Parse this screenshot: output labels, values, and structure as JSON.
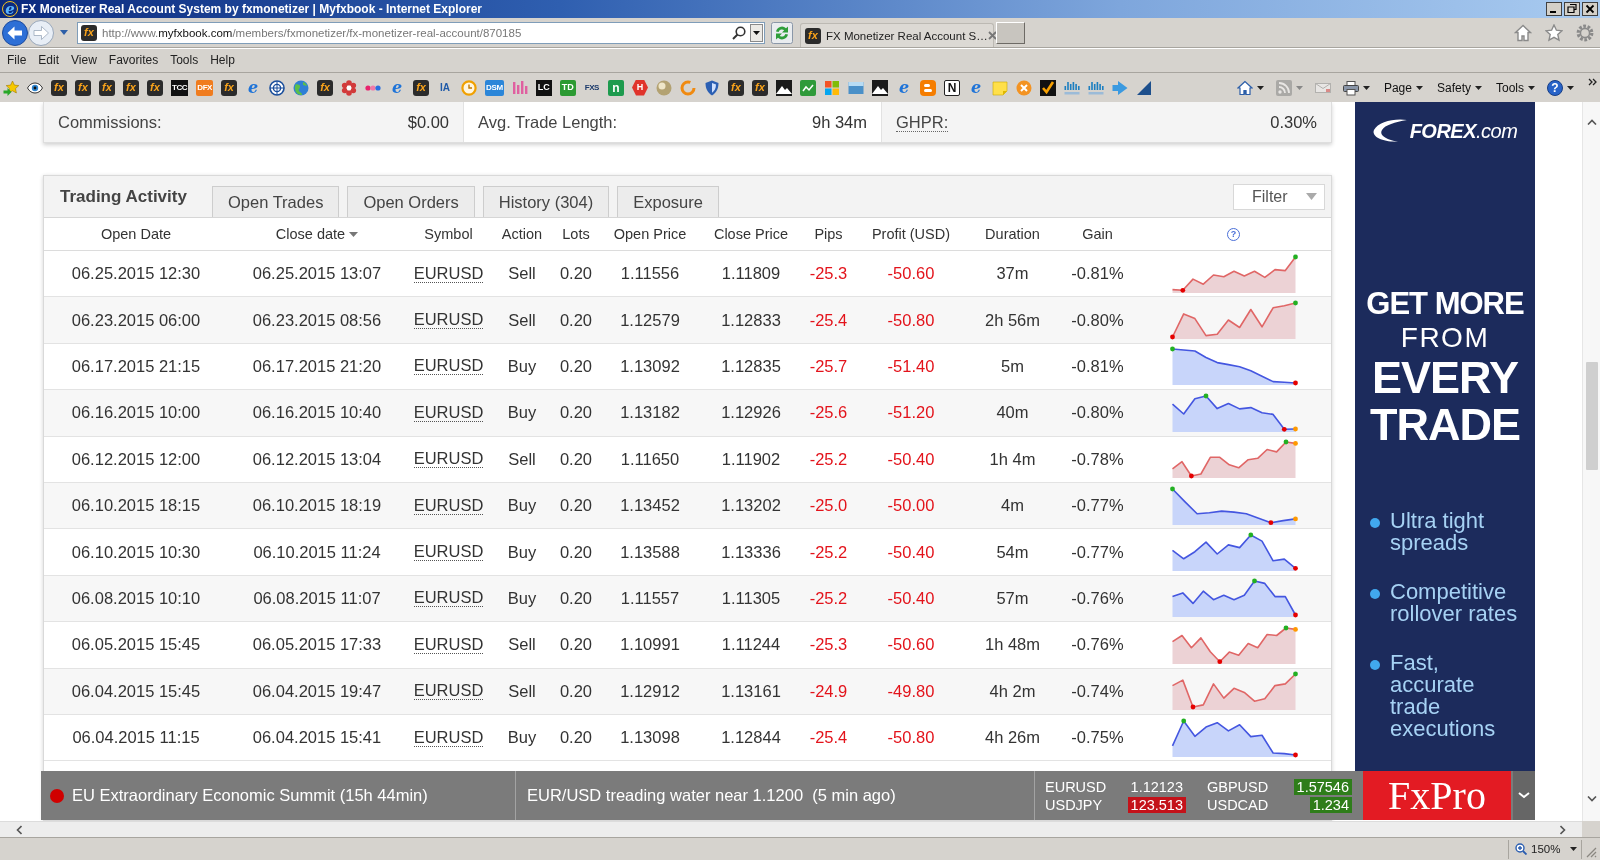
{
  "window": {
    "icon_text": "e",
    "title": "FX Monetizer Real Account System by fxmonetizer | Myfxbook - Internet Explorer"
  },
  "address": {
    "favicon_text": "fx",
    "url_start": "http://www.",
    "url_host": "myfxbook.com",
    "url_path": "/members/fxmonetizer/fx-monetizer-real-account/870185"
  },
  "tab": {
    "favicon_text": "fx",
    "title": "FX Monetizer Real Account S…"
  },
  "menu": [
    "File",
    "Edit",
    "View",
    "Favorites",
    "Tools",
    "Help"
  ],
  "favorites": [
    {
      "kind": "add"
    },
    {
      "kind": "eye"
    },
    {
      "kind": "fx",
      "text": "fx"
    },
    {
      "kind": "fx",
      "text": "fx"
    },
    {
      "kind": "fx",
      "text": "fx"
    },
    {
      "kind": "fx",
      "text": "fx"
    },
    {
      "kind": "fx",
      "text": "fx"
    },
    {
      "kind": "dark",
      "text": "TCC"
    },
    {
      "kind": "solid",
      "text": "DFX",
      "color": "#f07c1e"
    },
    {
      "kind": "fx",
      "text": "fx"
    },
    {
      "kind": "ie",
      "text": "e"
    },
    {
      "kind": "target"
    },
    {
      "kind": "globe"
    },
    {
      "kind": "fx",
      "text": "fx"
    },
    {
      "kind": "flower"
    },
    {
      "kind": "dots"
    },
    {
      "kind": "ie",
      "text": "e"
    },
    {
      "kind": "fx",
      "text": "fx"
    },
    {
      "kind": "plain",
      "text": "IA",
      "color": "#1f5aa8"
    },
    {
      "kind": "clock"
    },
    {
      "kind": "solid",
      "text": "DSM",
      "color": "#2b86d9"
    },
    {
      "kind": "bars"
    },
    {
      "kind": "dark",
      "text": "LC"
    },
    {
      "kind": "solid",
      "text": "TD",
      "color": "#2c9a32"
    },
    {
      "kind": "plain",
      "text": "FXS",
      "color": "#1b3a6b"
    },
    {
      "kind": "solid",
      "text": "n",
      "color": "#1e9b4e"
    },
    {
      "kind": "hex",
      "text": "H",
      "color": "#e0342c"
    },
    {
      "kind": "ball"
    },
    {
      "kind": "ring"
    },
    {
      "kind": "shield"
    },
    {
      "kind": "fx",
      "text": "fx"
    },
    {
      "kind": "fx",
      "text": "fx"
    },
    {
      "kind": "mountain"
    },
    {
      "kind": "chart"
    },
    {
      "kind": "windows"
    },
    {
      "kind": "window"
    },
    {
      "kind": "mountain"
    },
    {
      "kind": "ie",
      "text": "e"
    },
    {
      "kind": "blog"
    },
    {
      "kind": "outline",
      "text": "N"
    },
    {
      "kind": "ie",
      "text": "e"
    },
    {
      "kind": "note"
    },
    {
      "kind": "xcircle"
    },
    {
      "kind": "check"
    },
    {
      "kind": "cisco"
    },
    {
      "kind": "cisco"
    },
    {
      "kind": "plane"
    },
    {
      "kind": "slope"
    }
  ],
  "command_bar": [
    {
      "kind": "home",
      "disabled": false
    },
    {
      "kind": "feeds",
      "disabled": true
    },
    {
      "kind": "mail",
      "disabled": true
    },
    {
      "kind": "print",
      "disabled": false
    },
    {
      "kind": "menu",
      "label": "Page",
      "disabled": false
    },
    {
      "kind": "menu",
      "label": "Safety",
      "disabled": false
    },
    {
      "kind": "menu",
      "label": "Tools",
      "disabled": false
    },
    {
      "kind": "help",
      "label": "?",
      "disabled": false
    }
  ],
  "stats": [
    {
      "kind": "plain",
      "label": "Commissions:",
      "value": "$0.00"
    },
    {
      "kind": "plain",
      "label": "Avg. Trade Length:",
      "value": "9h 34m"
    },
    {
      "kind": "term",
      "label": "GHPR:",
      "value": "0.30%"
    }
  ],
  "activity": {
    "title": "Trading Activity",
    "tabs": [
      {
        "label": "Open Trades",
        "selected": false
      },
      {
        "label": "Open Orders",
        "selected": false
      },
      {
        "label": "History (304)",
        "selected": false
      },
      {
        "label": "Exposure",
        "selected": false
      }
    ],
    "filter": "Filter",
    "columns": [
      {
        "kind": "text",
        "label": "Open Date",
        "sorted": false
      },
      {
        "kind": "text",
        "label": "Close date",
        "sorted": true
      },
      {
        "kind": "text",
        "label": "Symbol",
        "sorted": false
      },
      {
        "kind": "text",
        "label": "Action",
        "sorted": false
      },
      {
        "kind": "text",
        "label": "Lots",
        "sorted": false
      },
      {
        "kind": "text",
        "label": "Open Price",
        "sorted": false
      },
      {
        "kind": "text",
        "label": "Close Price",
        "sorted": false
      },
      {
        "kind": "text",
        "label": "Pips",
        "sorted": false
      },
      {
        "kind": "text",
        "label": "Profit (USD)",
        "sorted": false
      },
      {
        "kind": "text",
        "label": "Duration",
        "sorted": false
      },
      {
        "kind": "text",
        "label": "Gain",
        "sorted": false
      },
      {
        "kind": "help",
        "label": "?",
        "sorted": false
      }
    ],
    "rows": [
      {
        "kind": "sell",
        "open_date": "06.25.2015 12:30",
        "close_date": "06.25.2015 13:07",
        "symbol": "EURUSD",
        "action": "Sell",
        "lots": "0.20",
        "open_price": "1.11556",
        "close_price": "1.11809",
        "pips": "-25.3",
        "profit": "-50.60",
        "duration": "37m",
        "gain": "-0.81%"
      },
      {
        "kind": "sell",
        "open_date": "06.23.2015 06:00",
        "close_date": "06.23.2015 08:56",
        "symbol": "EURUSD",
        "action": "Sell",
        "lots": "0.20",
        "open_price": "1.12579",
        "close_price": "1.12833",
        "pips": "-25.4",
        "profit": "-50.80",
        "duration": "2h 56m",
        "gain": "-0.80%"
      },
      {
        "kind": "buy",
        "open_date": "06.17.2015 21:15",
        "close_date": "06.17.2015 21:20",
        "symbol": "EURUSD",
        "action": "Buy",
        "lots": "0.20",
        "open_price": "1.13092",
        "close_price": "1.12835",
        "pips": "-25.7",
        "profit": "-51.40",
        "duration": "5m",
        "gain": "-0.81%"
      },
      {
        "kind": "buy",
        "open_date": "06.16.2015 10:00",
        "close_date": "06.16.2015 10:40",
        "symbol": "EURUSD",
        "action": "Buy",
        "lots": "0.20",
        "open_price": "1.13182",
        "close_price": "1.12926",
        "pips": "-25.6",
        "profit": "-51.20",
        "duration": "40m",
        "gain": "-0.80%"
      },
      {
        "kind": "sell",
        "open_date": "06.12.2015 12:00",
        "close_date": "06.12.2015 13:04",
        "symbol": "EURUSD",
        "action": "Sell",
        "lots": "0.20",
        "open_price": "1.11650",
        "close_price": "1.11902",
        "pips": "-25.2",
        "profit": "-50.40",
        "duration": "1h 4m",
        "gain": "-0.78%"
      },
      {
        "kind": "buy",
        "open_date": "06.10.2015 18:15",
        "close_date": "06.10.2015 18:19",
        "symbol": "EURUSD",
        "action": "Buy",
        "lots": "0.20",
        "open_price": "1.13452",
        "close_price": "1.13202",
        "pips": "-25.0",
        "profit": "-50.00",
        "duration": "4m",
        "gain": "-0.77%"
      },
      {
        "kind": "buy",
        "open_date": "06.10.2015 10:30",
        "close_date": "06.10.2015 11:24",
        "symbol": "EURUSD",
        "action": "Buy",
        "lots": "0.20",
        "open_price": "1.13588",
        "close_price": "1.13336",
        "pips": "-25.2",
        "profit": "-50.40",
        "duration": "54m",
        "gain": "-0.77%"
      },
      {
        "kind": "buy",
        "open_date": "06.08.2015 10:10",
        "close_date": "06.08.2015 11:07",
        "symbol": "EURUSD",
        "action": "Buy",
        "lots": "0.20",
        "open_price": "1.11557",
        "close_price": "1.11305",
        "pips": "-25.2",
        "profit": "-50.40",
        "duration": "57m",
        "gain": "-0.76%"
      },
      {
        "kind": "sell",
        "open_date": "06.05.2015 15:45",
        "close_date": "06.05.2015 17:33",
        "symbol": "EURUSD",
        "action": "Sell",
        "lots": "0.20",
        "open_price": "1.10991",
        "close_price": "1.11244",
        "pips": "-25.3",
        "profit": "-50.60",
        "duration": "1h 48m",
        "gain": "-0.76%"
      },
      {
        "kind": "sell",
        "open_date": "06.04.2015 15:45",
        "close_date": "06.04.2015 19:47",
        "symbol": "EURUSD",
        "action": "Sell",
        "lots": "0.20",
        "open_price": "1.12912",
        "close_price": "1.13161",
        "pips": "-24.9",
        "profit": "-49.80",
        "duration": "4h 2m",
        "gain": "-0.74%"
      },
      {
        "kind": "buy",
        "open_date": "06.04.2015 11:15",
        "close_date": "06.04.2015 15:41",
        "symbol": "EURUSD",
        "action": "Buy",
        "lots": "0.20",
        "open_price": "1.13098",
        "close_price": "1.12844",
        "pips": "-25.4",
        "profit": "-50.80",
        "duration": "4h 26m",
        "gain": "-0.75%"
      }
    ]
  },
  "ad": {
    "logo": "**FOREX**.com",
    "headline": [
      {
        "kind": "bold",
        "text": "GET MORE"
      },
      {
        "kind": "light",
        "text": "FROM"
      },
      {
        "kind": "large",
        "text": "EVERY"
      },
      {
        "kind": "large",
        "text": "TRADE"
      }
    ],
    "bullets": [
      "Ultra tight spreads",
      "Competitive rollover rates",
      "Fast, accurate trade executions"
    ]
  },
  "ticker": {
    "news": [
      {
        "kind": "event",
        "text": "EU Extraordinary Economic Summit (15h 44min)"
      },
      {
        "kind": "headline",
        "text": "EUR/USD treading water near 1.1200  (5 min ago)"
      }
    ],
    "quotes": [
      {
        "symbol": "EURUSD",
        "price": "1.12123"
      },
      {
        "symbol": "GBPUSD",
        "price": "1.57546",
        "color": "#2e7d1a"
      },
      {
        "symbol": "USDJPY",
        "price": "123.513",
        "color": "#c4121a"
      },
      {
        "symbol": "USDCAD",
        "price": "1.234",
        "color": "#2e7d1a"
      }
    ],
    "brand": "FxPro"
  },
  "status_bar": {
    "zoom": "150%"
  }
}
